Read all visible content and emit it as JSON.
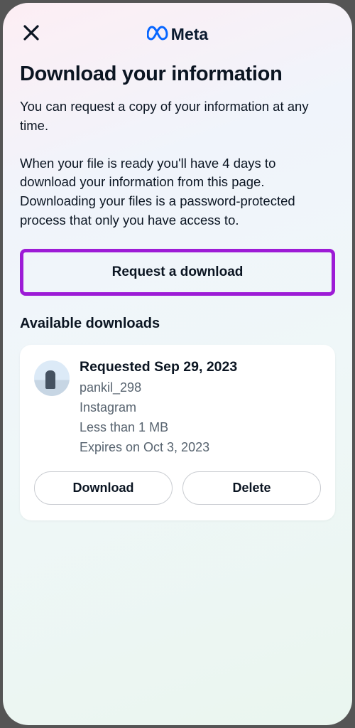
{
  "header": {
    "brand_name": "Meta"
  },
  "title": "Download your information",
  "description_para1": "You can request a copy of your information at any time.",
  "description_para2": "When your file is ready you'll have 4 days to download your information from this page. Downloading your files is a password-protected process that only you have access to.",
  "request_button_label": "Request a download",
  "available_section_title": "Available downloads",
  "download_item": {
    "title": "Requested Sep 29, 2023",
    "username": "pankil_298",
    "platform": "Instagram",
    "size": "Less than 1 MB",
    "expiry": "Expires on Oct 3, 2023",
    "download_label": "Download",
    "delete_label": "Delete"
  }
}
